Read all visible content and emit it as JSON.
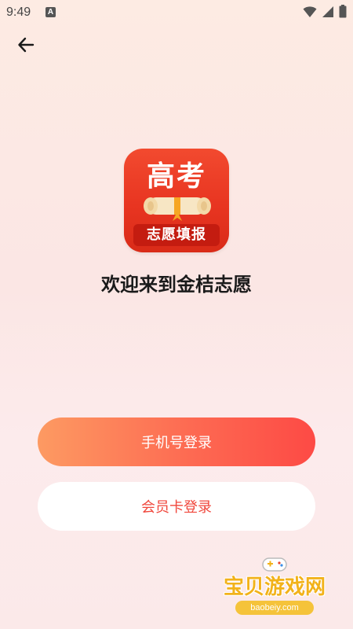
{
  "status_bar": {
    "time": "9:49",
    "notification_letter": "A"
  },
  "header": {
    "back_icon": "arrow-left-icon"
  },
  "logo": {
    "top_text": "高考",
    "band_text": "志愿填报"
  },
  "welcome_text": "欢迎来到金桔志愿",
  "buttons": {
    "phone_login": "手机号登录",
    "card_login": "会员卡登录"
  },
  "watermark": {
    "title": "宝贝游戏网",
    "url": "baobeiy.com"
  },
  "colors": {
    "accent_start": "#fd9a62",
    "accent_end": "#fd4a45",
    "card_button_text": "#f0473c",
    "logo_red": "#e83521"
  }
}
